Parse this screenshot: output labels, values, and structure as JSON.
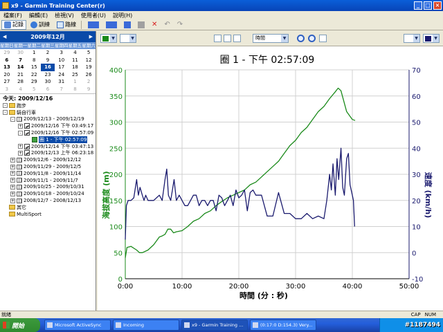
{
  "window": {
    "title": "x9 - Garmin Training Center(r)"
  },
  "menu": [
    "檔案(F)",
    "編輯(E)",
    "檢視(V)",
    "使用者(U)",
    "說明(H)"
  ],
  "toolbar": {
    "history_label": "記錄",
    "training_label": "訓練",
    "courses_label": "路線"
  },
  "calendar": {
    "month_title": "2009年12月",
    "dow": [
      "星期日",
      "星期一",
      "星期二",
      "星期三",
      "星期四",
      "星期五",
      "星期六"
    ],
    "days": [
      {
        "d": "29",
        "c": "dim"
      },
      {
        "d": "30",
        "c": "dim"
      },
      {
        "d": "1",
        "c": ""
      },
      {
        "d": "2",
        "c": ""
      },
      {
        "d": "3",
        "c": ""
      },
      {
        "d": "4",
        "c": ""
      },
      {
        "d": "5",
        "c": ""
      },
      {
        "d": "6",
        "c": "bold"
      },
      {
        "d": "7",
        "c": "bold"
      },
      {
        "d": "8",
        "c": ""
      },
      {
        "d": "9",
        "c": ""
      },
      {
        "d": "10",
        "c": ""
      },
      {
        "d": "11",
        "c": ""
      },
      {
        "d": "12",
        "c": ""
      },
      {
        "d": "13",
        "c": "bold"
      },
      {
        "d": "14",
        "c": "bold"
      },
      {
        "d": "15",
        "c": ""
      },
      {
        "d": "16",
        "c": "sel"
      },
      {
        "d": "17",
        "c": ""
      },
      {
        "d": "18",
        "c": ""
      },
      {
        "d": "19",
        "c": ""
      },
      {
        "d": "20",
        "c": ""
      },
      {
        "d": "21",
        "c": ""
      },
      {
        "d": "22",
        "c": ""
      },
      {
        "d": "23",
        "c": ""
      },
      {
        "d": "24",
        "c": ""
      },
      {
        "d": "25",
        "c": ""
      },
      {
        "d": "26",
        "c": ""
      },
      {
        "d": "27",
        "c": ""
      },
      {
        "d": "28",
        "c": ""
      },
      {
        "d": "29",
        "c": ""
      },
      {
        "d": "30",
        "c": ""
      },
      {
        "d": "31",
        "c": ""
      },
      {
        "d": "1",
        "c": "dim"
      },
      {
        "d": "2",
        "c": "dim"
      },
      {
        "d": "3",
        "c": "dim"
      },
      {
        "d": "4",
        "c": "dim"
      },
      {
        "d": "5",
        "c": "dim"
      },
      {
        "d": "6",
        "c": "dim"
      },
      {
        "d": "7",
        "c": "dim"
      },
      {
        "d": "8",
        "c": "dim"
      },
      {
        "d": "9",
        "c": "dim"
      }
    ],
    "today_label": "今天: 2009/12/16"
  },
  "tree": [
    {
      "indent": 0,
      "pm": "-",
      "icon": "fold",
      "label": "跑步",
      "name": "tree-running"
    },
    {
      "indent": 0,
      "pm": "-",
      "icon": "fold",
      "label": "騎自行車",
      "name": "tree-cycling"
    },
    {
      "indent": 1,
      "pm": "-",
      "icon": "cal",
      "label": "2009/12/13 - 2009/12/19",
      "name": "tree-week"
    },
    {
      "indent": 2,
      "pm": "+",
      "icon": "act",
      "label": "2009/12/16 下午 03:49:17",
      "name": "tree-activity"
    },
    {
      "indent": 2,
      "pm": "-",
      "icon": "act",
      "label": "2009/12/16 下午 02:57:09",
      "name": "tree-activity"
    },
    {
      "indent": 3,
      "pm": "",
      "icon": "lap",
      "label": "圈 1 - 下午 02:57:09",
      "name": "tree-lap-selected",
      "sel": true
    },
    {
      "indent": 2,
      "pm": "+",
      "icon": "act",
      "label": "2009/12/14 下午 03:47:13",
      "name": "tree-activity"
    },
    {
      "indent": 2,
      "pm": "+",
      "icon": "act",
      "label": "2009/12/13 上午 06:23:18",
      "name": "tree-activity"
    },
    {
      "indent": 1,
      "pm": "+",
      "icon": "cal",
      "label": "2009/12/6 - 2009/12/12",
      "name": "tree-week"
    },
    {
      "indent": 1,
      "pm": "+",
      "icon": "cal",
      "label": "2009/11/29 - 2009/12/5",
      "name": "tree-week"
    },
    {
      "indent": 1,
      "pm": "+",
      "icon": "cal",
      "label": "2009/11/8 - 2009/11/14",
      "name": "tree-week"
    },
    {
      "indent": 1,
      "pm": "+",
      "icon": "cal",
      "label": "2009/11/1 - 2009/11/7",
      "name": "tree-week"
    },
    {
      "indent": 1,
      "pm": "+",
      "icon": "cal",
      "label": "2009/10/25 - 2009/10/31",
      "name": "tree-week"
    },
    {
      "indent": 1,
      "pm": "+",
      "icon": "cal",
      "label": "2009/10/18 - 2009/10/24",
      "name": "tree-week"
    },
    {
      "indent": 1,
      "pm": "+",
      "icon": "cal",
      "label": "2008/12/7 - 2008/12/13",
      "name": "tree-week"
    },
    {
      "indent": 0,
      "pm": "",
      "icon": "fold",
      "label": "其它",
      "name": "tree-other"
    },
    {
      "indent": 0,
      "pm": "",
      "icon": "fold",
      "label": "MultiSport",
      "name": "tree-multisport"
    }
  ],
  "chart_toolbar": {
    "x_axis_select": "時間",
    "left_series_color": "#1a8a1a",
    "right_series_color": "#1a1a6e"
  },
  "chart_data": {
    "type": "line",
    "title": "圈 1 - 下午 02:57:09",
    "xlabel": "時間 (分 : 秒)",
    "ylabel": "海拔高度 (m)",
    "y2label": "速度 (km/h)",
    "x_ticks": [
      "0:00",
      "10:00",
      "20:00",
      "30:00",
      "40:00",
      "50:00"
    ],
    "xlim": [
      0,
      50
    ],
    "y_ticks": [
      "0",
      "50",
      "100",
      "150",
      "200",
      "250",
      "300",
      "350",
      "400"
    ],
    "ylim": [
      0,
      400
    ],
    "y2_ticks": [
      "-10",
      "0",
      "10",
      "20",
      "30",
      "40",
      "50",
      "60",
      "70"
    ],
    "y2lim": [
      -10,
      70
    ],
    "grid": true,
    "series": [
      {
        "name": "海拔高度 (m)",
        "axis": "left",
        "color": "#1a8a1a",
        "x": [
          0,
          0.3,
          1,
          2,
          2.5,
          3,
          4,
          5,
          6,
          6.5,
          7,
          7.5,
          8,
          8.5,
          9,
          10,
          11,
          12,
          13,
          14,
          15,
          16,
          17,
          18,
          19,
          20,
          21,
          22,
          23,
          24,
          25,
          26,
          27,
          28,
          29,
          30,
          31,
          32,
          33,
          34,
          35,
          36,
          37,
          37.5,
          38,
          38.5,
          39,
          40,
          40.5
        ],
        "y": [
          40,
          60,
          62,
          55,
          50,
          50,
          55,
          65,
          80,
          82,
          85,
          95,
          95,
          88,
          90,
          92,
          100,
          110,
          115,
          125,
          130,
          140,
          148,
          155,
          160,
          165,
          170,
          180,
          185,
          195,
          205,
          215,
          225,
          240,
          255,
          265,
          280,
          290,
          305,
          320,
          330,
          345,
          358,
          365,
          360,
          340,
          320,
          305,
          303
        ]
      },
      {
        "name": "速度 (km/h)",
        "axis": "right",
        "color": "#1a1a6e",
        "x": [
          0,
          0.2,
          0.5,
          1,
          1.5,
          2,
          2.3,
          2.6,
          3,
          3.3,
          3.6,
          4,
          4.5,
          5,
          5.5,
          6,
          6.5,
          7,
          7.3,
          7.6,
          8,
          8.3,
          8.6,
          9,
          9.5,
          10,
          10.5,
          11,
          11.5,
          12,
          12.5,
          13,
          13.5,
          14,
          14.5,
          15,
          15.5,
          16,
          16.5,
          17,
          17.5,
          18,
          18.5,
          19,
          19.5,
          20,
          20.5,
          21,
          21.5,
          22,
          22.5,
          23,
          23.5,
          24,
          25,
          26,
          27,
          28,
          29,
          30,
          31,
          32,
          33,
          34,
          35,
          35.5,
          36,
          36.3,
          36.6,
          37,
          37.3,
          37.6,
          38,
          38.3,
          38.6,
          39,
          39.3,
          39.6,
          40,
          40.2,
          40.4
        ],
        "y": [
          5,
          18,
          20,
          20,
          21,
          28,
          22,
          25,
          22,
          20,
          22,
          20,
          20,
          20,
          21,
          22,
          20,
          28,
          32,
          22,
          20,
          24,
          28,
          20,
          22,
          20,
          18,
          18,
          20,
          22,
          22,
          18,
          20,
          20,
          18,
          20,
          20,
          16,
          22,
          21,
          18,
          20,
          22,
          18,
          24,
          21,
          22,
          24,
          16,
          23,
          24,
          22,
          22,
          22,
          14,
          14,
          23,
          15,
          15,
          13,
          13,
          15,
          13,
          14,
          13,
          20,
          30,
          24,
          34,
          22,
          36,
          28,
          40,
          25,
          22,
          36,
          38,
          26,
          22,
          20,
          10
        ]
      }
    ]
  },
  "status": {
    "left": "就緒",
    "caps": "CAP",
    "num": "NUM"
  },
  "taskbar": {
    "start_label": "開始",
    "tasks": [
      "Microsoft ActiveSync",
      "Incoming",
      "x9 - Garmin Training ...",
      "(0:17:0 D:154.3) Very..."
    ],
    "watermark": "#1187494"
  }
}
